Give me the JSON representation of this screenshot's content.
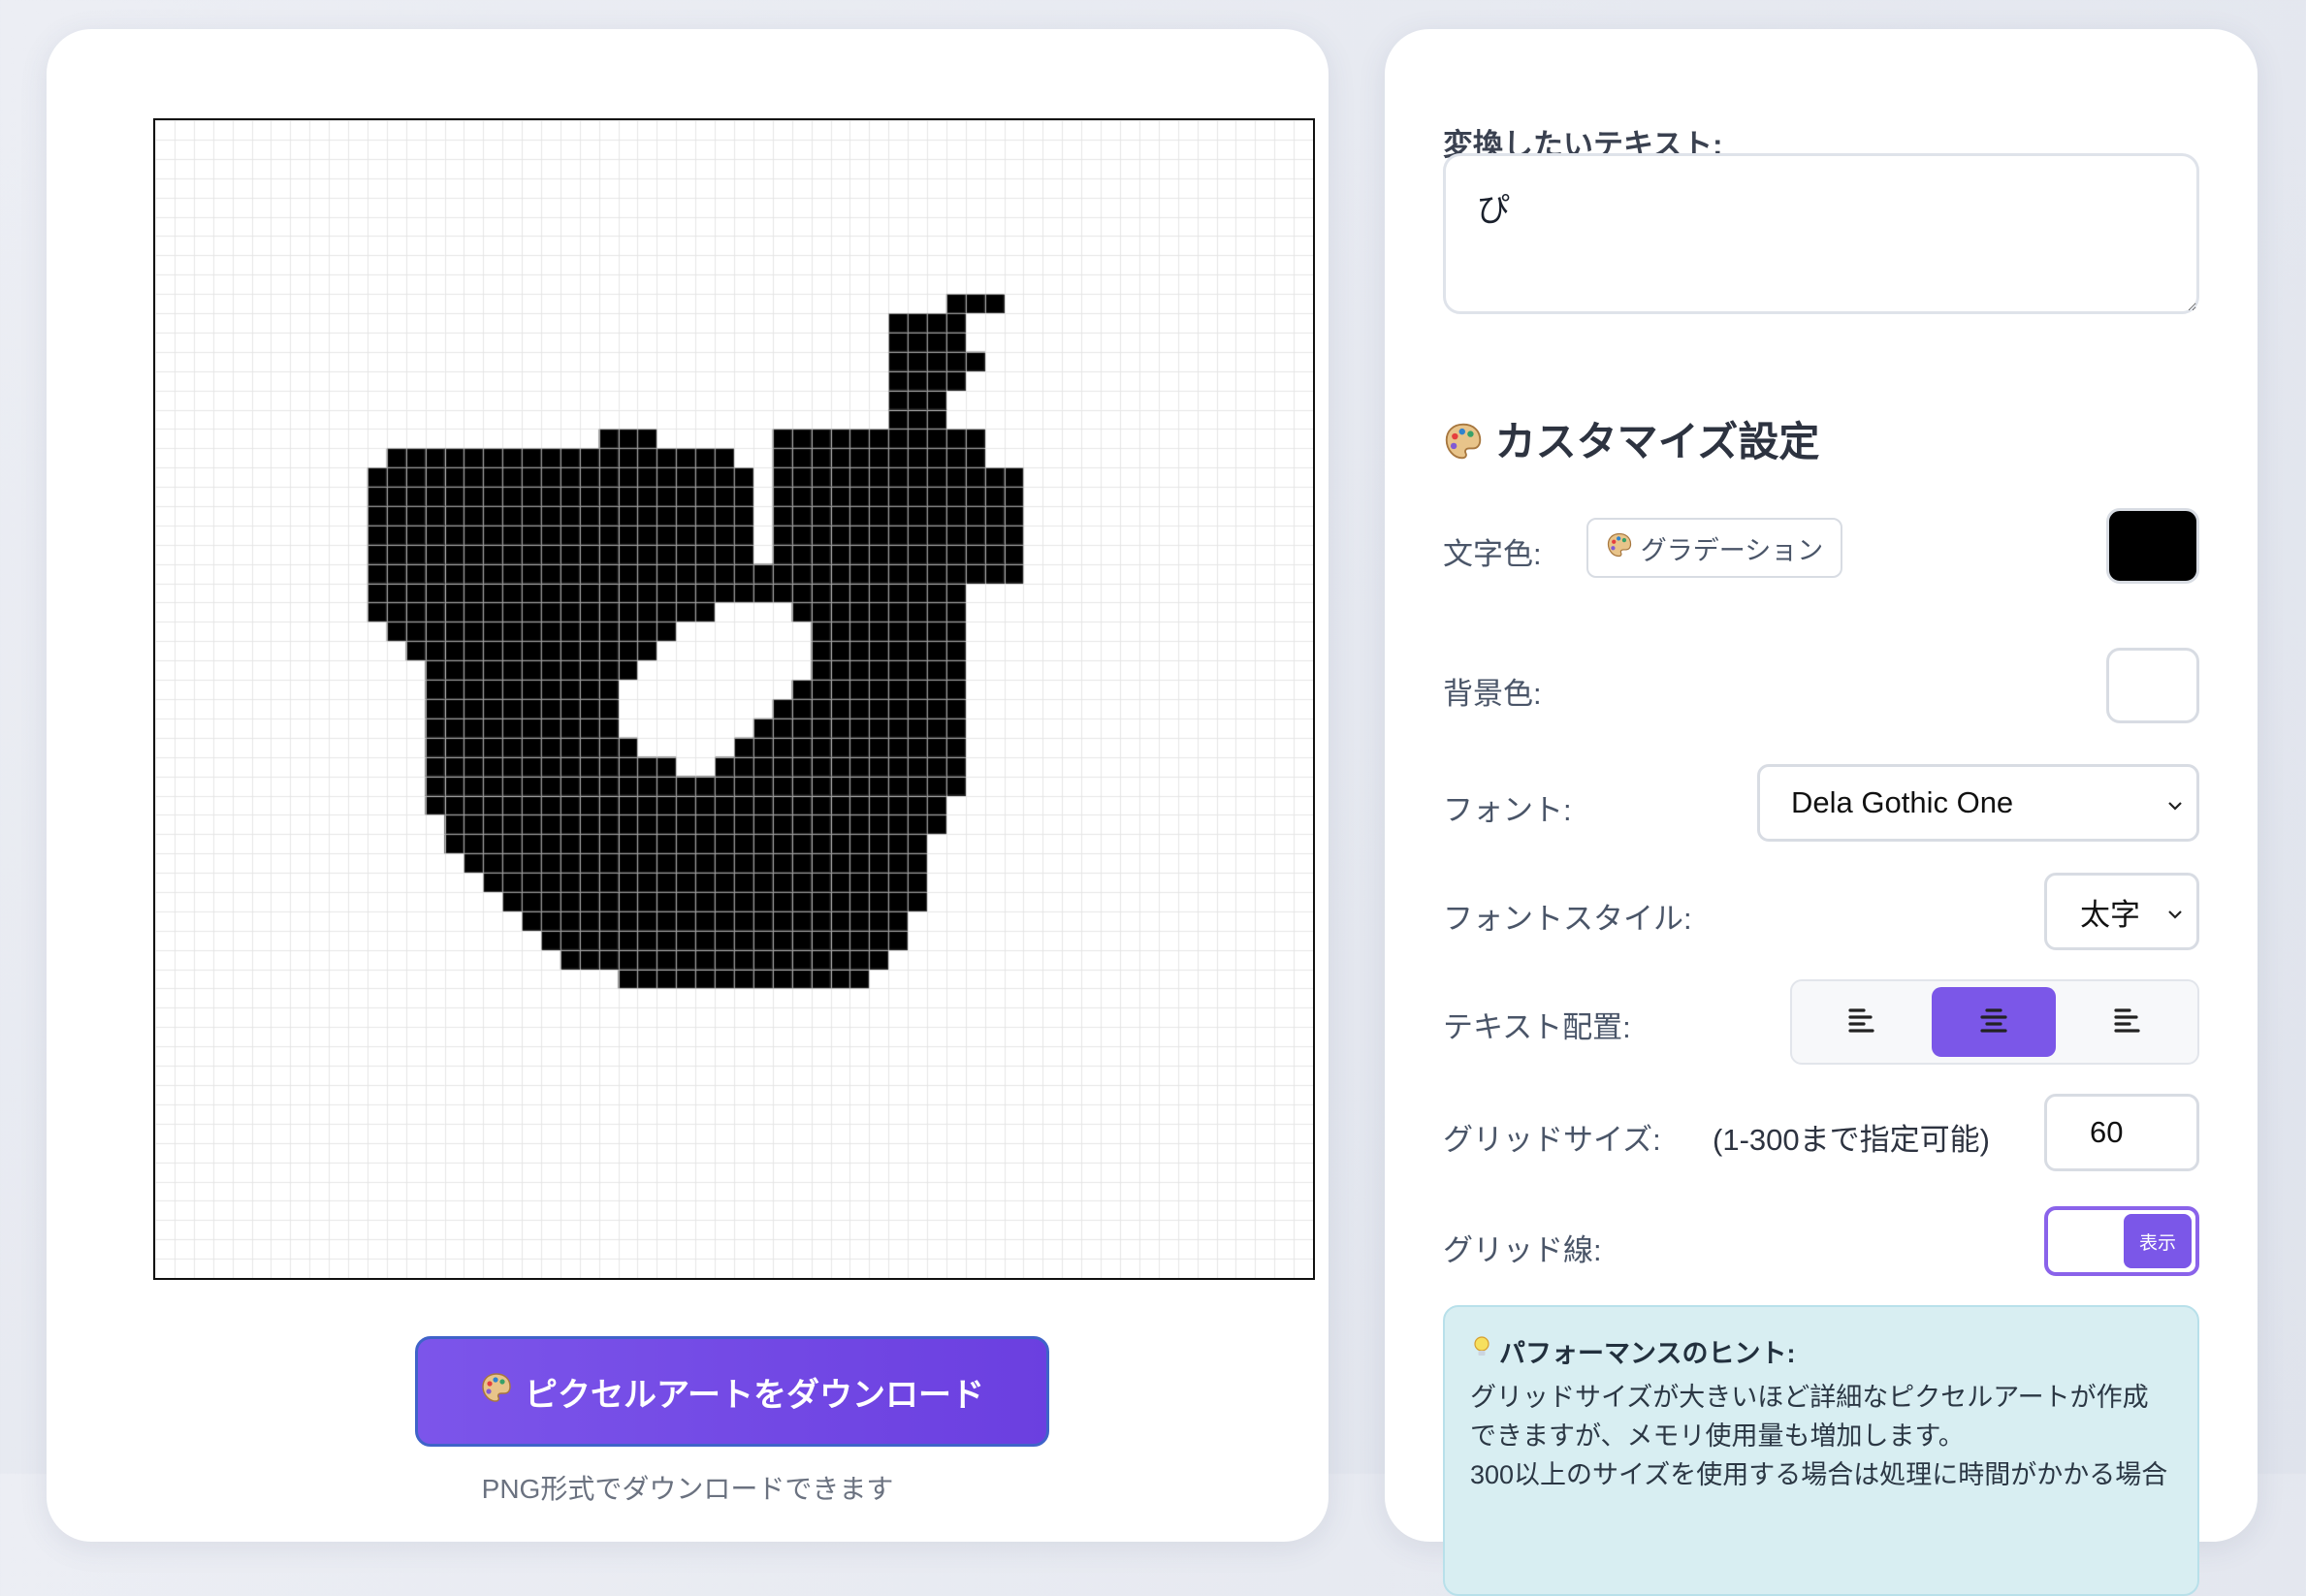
{
  "preview": {
    "download_label": "ピクセルアートをダウンロード",
    "download_icon": "palette-icon",
    "download_note": "PNG形式でダウンロードできます",
    "grid_columns": 60,
    "grid_rows": 60,
    "pixel_color": "#000000",
    "background_color": "#ffffff",
    "grid_line_color": "#e6e6e6",
    "filled_rows": [
      [
        10,
        40,
        42
      ],
      [
        11,
        39,
        42
      ],
      [
        12,
        38,
        43
      ],
      [
        13,
        38,
        43
      ],
      [
        14,
        38,
        41
      ],
      [
        15,
        38,
        41
      ],
      [
        16,
        38,
        43
      ],
      [
        17,
        12,
        30
      ],
      [
        18,
        11,
        31
      ],
      [
        19,
        11,
        31
      ],
      [
        20,
        11,
        31
      ],
      [
        21,
        11,
        42
      ],
      [
        22,
        11,
        42
      ],
      [
        23,
        11,
        42
      ],
      [
        24,
        11,
        42
      ],
      [
        25,
        11,
        42
      ],
      [
        26,
        12,
        42
      ],
      [
        27,
        13,
        42
      ],
      [
        28,
        14,
        42
      ],
      [
        29,
        14,
        42
      ],
      [
        30,
        14,
        42
      ],
      [
        31,
        14,
        42
      ],
      [
        32,
        14,
        42
      ],
      [
        33,
        14,
        42
      ],
      [
        34,
        14,
        42
      ],
      [
        35,
        14,
        41
      ],
      [
        36,
        15,
        41
      ],
      [
        37,
        15,
        40
      ],
      [
        38,
        16,
        40
      ],
      [
        39,
        17,
        40
      ],
      [
        40,
        18,
        40
      ],
      [
        41,
        19,
        39
      ],
      [
        42,
        20,
        39
      ],
      [
        43,
        21,
        38
      ],
      [
        44,
        24,
        37
      ]
    ],
    "filled_segments": [
      [
        9,
        41,
        44
      ],
      [
        10,
        38,
        42
      ],
      [
        11,
        38,
        42
      ],
      [
        12,
        38,
        43
      ],
      [
        13,
        38,
        43
      ],
      [
        14,
        38,
        41
      ],
      [
        15,
        38,
        41
      ],
      [
        16,
        23,
        26
      ],
      [
        16,
        32,
        43
      ],
      [
        17,
        32,
        43
      ],
      [
        18,
        32,
        45
      ],
      [
        19,
        32,
        45
      ],
      [
        20,
        32,
        45
      ],
      [
        21,
        32,
        45
      ],
      [
        22,
        32,
        45
      ],
      [
        23,
        32,
        45
      ]
    ],
    "holes": [
      [
        13,
        42,
        43
      ],
      [
        14,
        42,
        43
      ],
      [
        21,
        31,
        32
      ],
      [
        22,
        31,
        32
      ],
      [
        25,
        29,
        33
      ],
      [
        26,
        27,
        34
      ],
      [
        27,
        26,
        34
      ],
      [
        28,
        25,
        34
      ],
      [
        29,
        24,
        33
      ],
      [
        30,
        24,
        32
      ],
      [
        31,
        24,
        31
      ],
      [
        32,
        25,
        30
      ],
      [
        33,
        27,
        29
      ]
    ]
  },
  "form": {
    "text_label": "変換したいテキスト:",
    "text_value": "ぴ",
    "customize_title": "カスタマイズ設定",
    "customize_icon": "palette-icon",
    "text_color_label": "文字色:",
    "gradient_button_label": "グラデーション",
    "text_color": "#000000",
    "bg_color_label": "背景色:",
    "bg_color": "#ffffff",
    "font_label": "フォント:",
    "font_value": "Dela Gothic One",
    "font_style_label": "フォントスタイル:",
    "font_style_value": "太字",
    "align_label": "テキスト配置:",
    "align_options": [
      "left",
      "center",
      "right"
    ],
    "align_selected": "center",
    "grid_size_label": "グリッドサイズ:",
    "grid_size_hint": "(1-300まで指定可能)",
    "grid_size_value": "60",
    "grid_lines_label": "グリッド線:",
    "grid_lines_toggle_label": "表示",
    "accent_color": "#7b57e8"
  },
  "hint": {
    "title": "パフォーマンスのヒント:",
    "icon": "lightbulb-icon",
    "line1": "グリッドサイズが大きいほど詳細なピクセルアートが作成",
    "line2": "できますが、メモリ使用量も増加します。",
    "line3": "300以上のサイズを使用する場合は処理に時間がかかる場合"
  }
}
